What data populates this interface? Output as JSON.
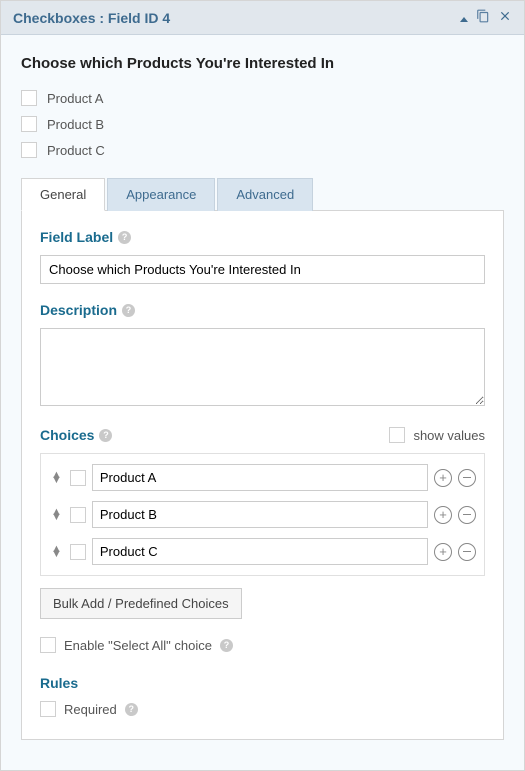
{
  "header": {
    "title": "Checkboxes : Field ID 4"
  },
  "preview": {
    "heading": "Choose which Products You're Interested In",
    "items": [
      "Product A",
      "Product B",
      "Product C"
    ]
  },
  "tabs": {
    "general": "General",
    "appearance": "Appearance",
    "advanced": "Advanced"
  },
  "general": {
    "field_label_title": "Field Label",
    "field_label_value": "Choose which Products You're Interested In",
    "description_title": "Description",
    "description_value": "",
    "choices_title": "Choices",
    "show_values_label": "show values",
    "choices": [
      "Product A",
      "Product B",
      "Product C"
    ],
    "bulk_button": "Bulk Add / Predefined Choices",
    "select_all_label": "Enable \"Select All\" choice",
    "rules_title": "Rules",
    "required_label": "Required"
  }
}
